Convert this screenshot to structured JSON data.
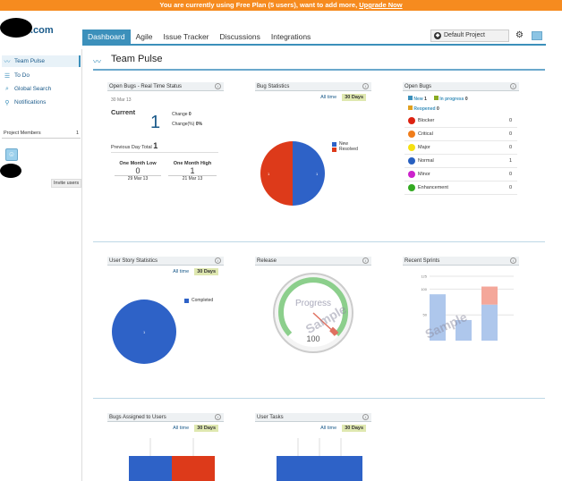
{
  "banner": {
    "text": "You are currently using Free Plan (5 users), want to add more,",
    "link": "Upgrade Now"
  },
  "logo": {
    "suffix": ".com"
  },
  "nav": {
    "tabs": [
      "Dashboard",
      "Agile",
      "Issue Tracker",
      "Discussions",
      "Integrations"
    ],
    "active": "Dashboard",
    "project": "Default Project"
  },
  "sidebar": {
    "items": [
      {
        "label": "Team Pulse",
        "icon": "pulse-icon"
      },
      {
        "label": "To Do",
        "icon": "list-icon"
      },
      {
        "label": "Global Search",
        "icon": "search-icon"
      },
      {
        "label": "Notifications",
        "icon": "notification-icon"
      }
    ],
    "members_label": "Project Members",
    "members_count": "1",
    "invite": "Invite users"
  },
  "page": {
    "title": "Team Pulse"
  },
  "open_bugs_rt": {
    "title": "Open Bugs - Real Time Status",
    "date": "30 Mar 13",
    "current_label": "Current",
    "current": "1",
    "change_label": "Change",
    "change": "0",
    "change_pct_label": "Change(%)",
    "change_pct": "0%",
    "prev_label": "Previous Day Total",
    "prev": "1",
    "low_label": "One Month Low",
    "low": "0",
    "low_date": "29 Mar 13",
    "high_label": "One Month High",
    "high": "1",
    "high_date": "21 Mar 13"
  },
  "bug_stats": {
    "title": "Bug Statistics",
    "t1": "All time",
    "t2": "30 Days",
    "legend": [
      "New",
      "Resolved"
    ],
    "labels": [
      "1",
      "1"
    ]
  },
  "open_bugs": {
    "title": "Open Bugs",
    "new_label": "New",
    "new": "1",
    "prog_label": "In progress",
    "prog": "0",
    "reop_label": "Reopened",
    "reop": "0",
    "rows": [
      {
        "name": "Blocker",
        "v": "0",
        "c": "#dd2211"
      },
      {
        "name": "Critical",
        "v": "0",
        "c": "#f07d1a"
      },
      {
        "name": "Major",
        "v": "0",
        "c": "#f5e012"
      },
      {
        "name": "Normal",
        "v": "1",
        "c": "#2860c0"
      },
      {
        "name": "Minor",
        "v": "0",
        "c": "#cc22cc"
      },
      {
        "name": "Enhancement",
        "v": "0",
        "c": "#33aa22"
      }
    ]
  },
  "story_stats": {
    "title": "User Story Statistics",
    "t1": "All time",
    "t2": "30 Days",
    "legend": "Completed",
    "label": "1"
  },
  "release": {
    "title": "Release",
    "gauge_label": "Progress",
    "value": "100",
    "sample": "Sample"
  },
  "sprints": {
    "title": "Recent Sprints",
    "sample": "Sample"
  },
  "bugs_assigned": {
    "title": "Bugs Assigned to Users",
    "t1": "All time",
    "t2": "30 Days"
  },
  "user_tasks": {
    "title": "User Tasks",
    "t1": "All time",
    "t2": "30 Days"
  },
  "colors": {
    "accent": "#3c90bb",
    "red": "#dd3a1a",
    "blue": "#2e62c7"
  },
  "chart_data": [
    {
      "type": "pie",
      "title": "Bug Statistics",
      "series": [
        {
          "name": "New",
          "values": [
            1
          ]
        },
        {
          "name": "Resolved",
          "values": [
            1
          ]
        }
      ]
    },
    {
      "type": "pie",
      "title": "User Story Statistics",
      "series": [
        {
          "name": "Completed",
          "values": [
            1
          ]
        }
      ]
    },
    {
      "type": "bar",
      "title": "Recent Sprints",
      "ylim": [
        0,
        125
      ],
      "yticks": [
        "125",
        "100",
        "50"
      ],
      "stacks": [
        [
          90,
          0
        ],
        [
          40,
          0
        ],
        [
          70,
          35
        ]
      ]
    }
  ]
}
